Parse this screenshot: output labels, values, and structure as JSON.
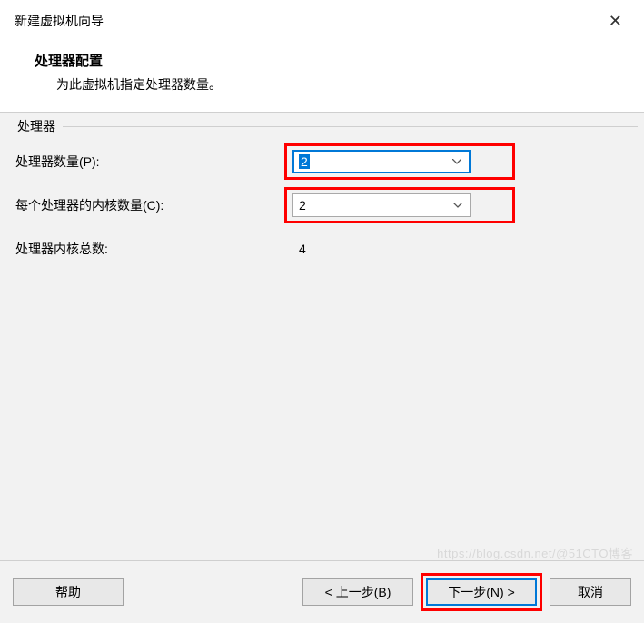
{
  "window": {
    "title": "新建虚拟机向导"
  },
  "header": {
    "title": "处理器配置",
    "subtitle": "为此虚拟机指定处理器数量。"
  },
  "group": {
    "label": "处理器",
    "rows": {
      "processors": {
        "label": "处理器数量(P):",
        "value": "2"
      },
      "cores": {
        "label": "每个处理器的内核数量(C):",
        "value": "2"
      },
      "total": {
        "label": "处理器内核总数:",
        "value": "4"
      }
    }
  },
  "buttons": {
    "help": "帮助",
    "back": "< 上一步(B)",
    "next": "下一步(N) >",
    "cancel": "取消"
  },
  "watermark": "https://blog.csdn.net/@51CTO博客"
}
